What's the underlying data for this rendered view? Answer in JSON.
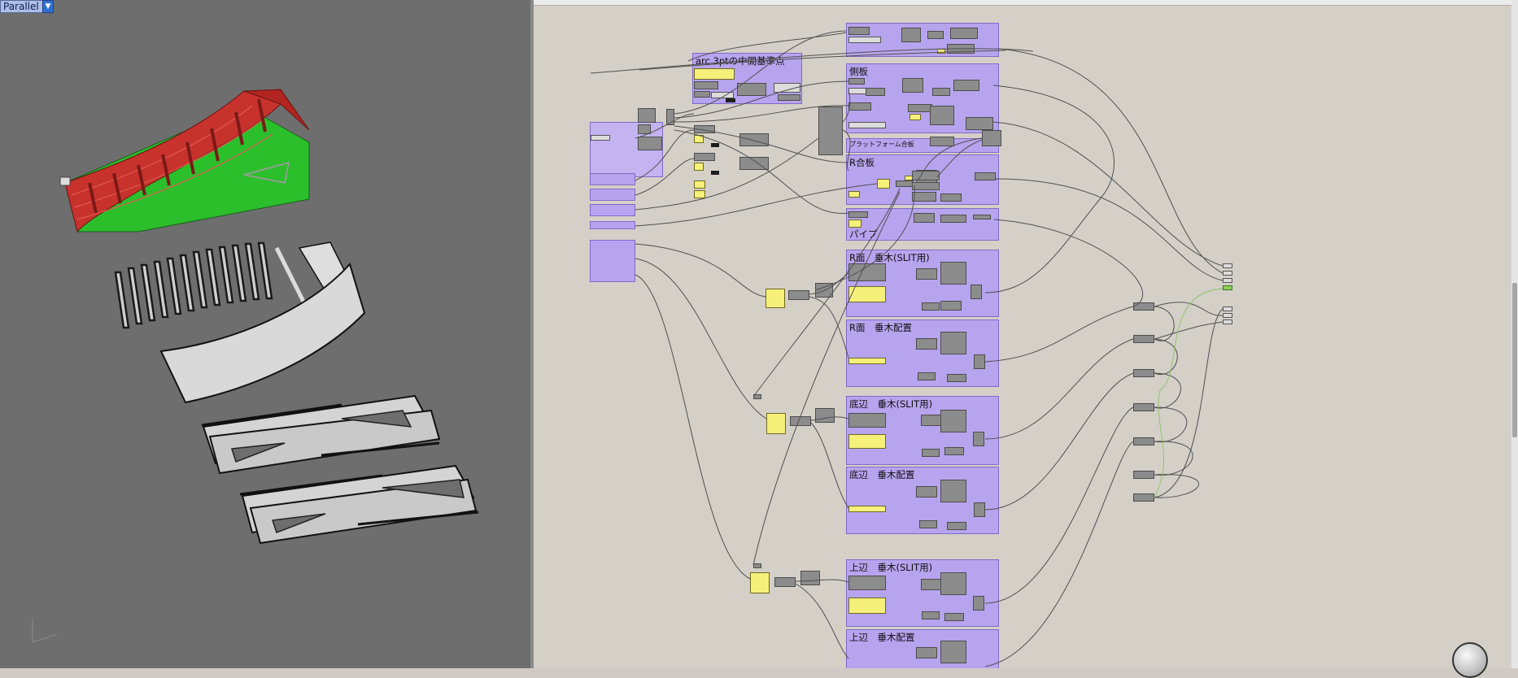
{
  "viewport": {
    "projection_label": "Parallel",
    "dropdown_symbol": "▼"
  },
  "canvas": {
    "groups": [
      {
        "id": "arc",
        "title": "arc 3ptの中間基準点"
      },
      {
        "id": "side",
        "title": "側板"
      },
      {
        "id": "platform",
        "title": "プラットフォーム合板"
      },
      {
        "id": "rgouhan",
        "title": "R合板"
      },
      {
        "id": "pipe",
        "title": "パイプ"
      },
      {
        "id": "r-slit",
        "title": "R面　垂木(SLIT用)"
      },
      {
        "id": "r-place",
        "title": "R面　垂木配置"
      },
      {
        "id": "bottom-slit",
        "title": "底辺　垂木(SLIT用)"
      },
      {
        "id": "bottom-place",
        "title": "底辺　垂木配置"
      },
      {
        "id": "top-slit",
        "title": "上辺　垂木(SLIT用)"
      },
      {
        "id": "top-place",
        "title": "上辺　垂木配置"
      }
    ]
  },
  "colors": {
    "viewport_bg": "#6e6e6e",
    "canvas_bg": "#d4d0c8",
    "group_fill": "#b7a4ee",
    "ramp_red": "#c8322d",
    "ramp_green": "#2bbf2b",
    "panel_yellow": "#f5f07a"
  },
  "icons": [
    "navigation-sphere-icon",
    "dropdown-arrow-icon"
  ]
}
